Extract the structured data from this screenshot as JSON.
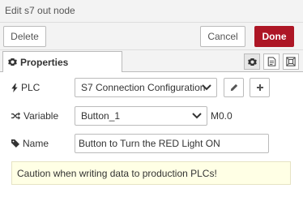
{
  "window": {
    "title": "Edit s7 out node"
  },
  "toolbar": {
    "delete_label": "Delete",
    "cancel_label": "Cancel",
    "done_label": "Done"
  },
  "tabs": {
    "properties_label": "Properties"
  },
  "form": {
    "plc": {
      "label": "PLC",
      "value": "S7 Connection Configuration"
    },
    "variable": {
      "label": "Variable",
      "value": "Button_1",
      "address": "M0.0"
    },
    "name": {
      "label": "Name",
      "value": "Button to Turn the RED Light ON"
    }
  },
  "notice": {
    "text": "Caution when writing data to production PLCs!"
  },
  "colors": {
    "accent": "#ad1625",
    "notice_bg": "#ffffe5",
    "toolbar_bg": "#f3f3f3"
  },
  "icons": [
    "gear-icon",
    "bolt-icon",
    "shuffle-icon",
    "tag-icon",
    "pencil-icon",
    "plus-icon",
    "chevron-down-icon",
    "description-icon",
    "appearance-icon"
  ]
}
